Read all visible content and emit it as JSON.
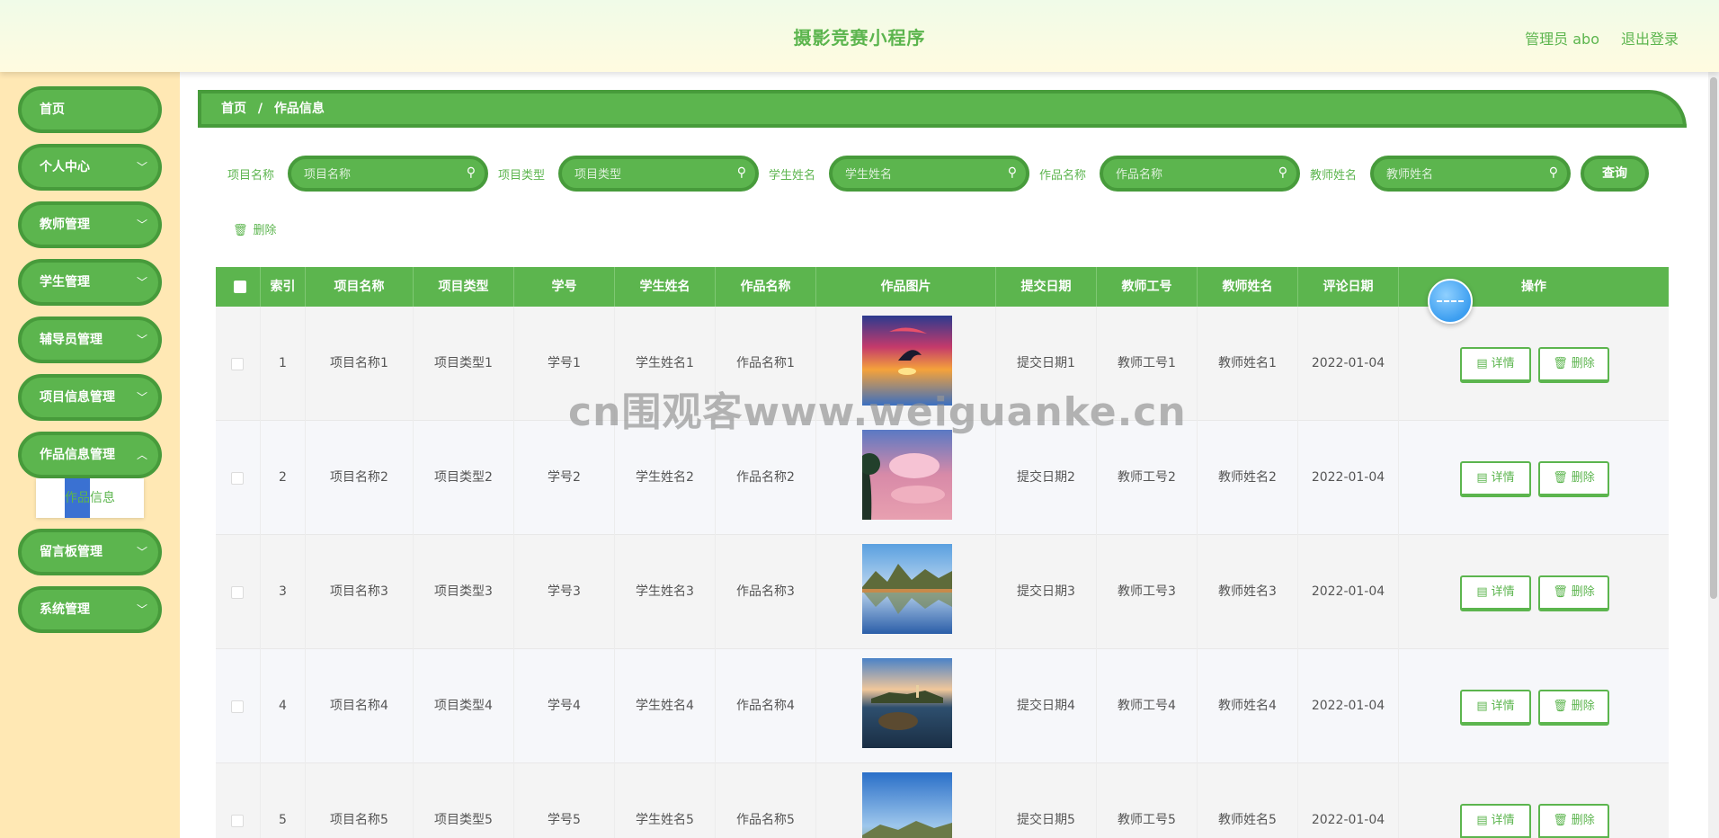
{
  "header": {
    "title": "摄影竞赛小程序",
    "user": "管理员 abo",
    "logout": "退出登录"
  },
  "sidebar": {
    "items": [
      {
        "label": "首页",
        "chevron": ""
      },
      {
        "label": "个人中心",
        "chevron": "﹀"
      },
      {
        "label": "教师管理",
        "chevron": "﹀"
      },
      {
        "label": "学生管理",
        "chevron": "﹀"
      },
      {
        "label": "辅导员管理",
        "chevron": "﹀"
      },
      {
        "label": "项目信息管理",
        "chevron": "﹀"
      },
      {
        "label": "作品信息管理",
        "chevron": "︿"
      },
      {
        "label": "留言板管理",
        "chevron": "﹀"
      },
      {
        "label": "系统管理",
        "chevron": "﹀"
      }
    ],
    "submenu_label": "作品信息"
  },
  "breadcrumb": {
    "home": "首页",
    "separator": "/",
    "current": "作品信息"
  },
  "search": {
    "fields": [
      {
        "label": "项目名称",
        "placeholder": "项目名称"
      },
      {
        "label": "项目类型",
        "placeholder": "项目类型"
      },
      {
        "label": "学生姓名",
        "placeholder": "学生姓名"
      },
      {
        "label": "作品名称",
        "placeholder": "作品名称"
      },
      {
        "label": "教师姓名",
        "placeholder": "教师姓名"
      }
    ],
    "button": "查询"
  },
  "toolbar": {
    "delete_label": "删除"
  },
  "table": {
    "columns": [
      "索引",
      "项目名称",
      "项目类型",
      "学号",
      "学生姓名",
      "作品名称",
      "作品图片",
      "提交日期",
      "教师工号",
      "教师姓名",
      "评论日期",
      "操作"
    ],
    "rows": [
      {
        "index": "1",
        "project_name": "项目名称1",
        "project_type": "项目类型1",
        "student_no": "学号1",
        "student_name": "学生姓名1",
        "work_name": "作品名称1",
        "image": "sunset-dolphin-photo",
        "submit_date": "提交日期1",
        "teacher_no": "教师工号1",
        "teacher_name": "教师姓名1",
        "comment_date": "2022-01-04"
      },
      {
        "index": "2",
        "project_name": "项目名称2",
        "project_type": "项目类型2",
        "student_no": "学号2",
        "student_name": "学生姓名2",
        "work_name": "作品名称2",
        "image": "pink-cloud-tree-photo",
        "submit_date": "提交日期2",
        "teacher_no": "教师工号2",
        "teacher_name": "教师姓名2",
        "comment_date": "2022-01-04"
      },
      {
        "index": "3",
        "project_name": "项目名称3",
        "project_type": "项目类型3",
        "student_no": "学号3",
        "student_name": "学生姓名3",
        "work_name": "作品名称3",
        "image": "mountain-lake-photo",
        "submit_date": "提交日期3",
        "teacher_no": "教师工号3",
        "teacher_name": "教师姓名3",
        "comment_date": "2022-01-04"
      },
      {
        "index": "4",
        "project_name": "项目名称4",
        "project_type": "项目类型4",
        "student_no": "学号4",
        "student_name": "学生姓名4",
        "work_name": "作品名称4",
        "image": "island-dusk-photo",
        "submit_date": "提交日期4",
        "teacher_no": "教师工号4",
        "teacher_name": "教师姓名4",
        "comment_date": "2022-01-04"
      },
      {
        "index": "5",
        "project_name": "项目名称5",
        "project_type": "项目类型5",
        "student_no": "学号5",
        "student_name": "学生姓名5",
        "work_name": "作品名称5",
        "image": "lake-sky-photo",
        "submit_date": "提交日期5",
        "teacher_no": "教师工号5",
        "teacher_name": "教师姓名5",
        "comment_date": "2022-01-04"
      }
    ],
    "detail_label": "详情",
    "delete_label": "删除"
  },
  "watermark": "cn围观客www.weiguanke.cn",
  "colors": {
    "primary": "#5cb54e",
    "primary_border": "#479b3b",
    "sidebar_bg": "#ffe8b4",
    "accent_blue": "#3a71d2"
  }
}
